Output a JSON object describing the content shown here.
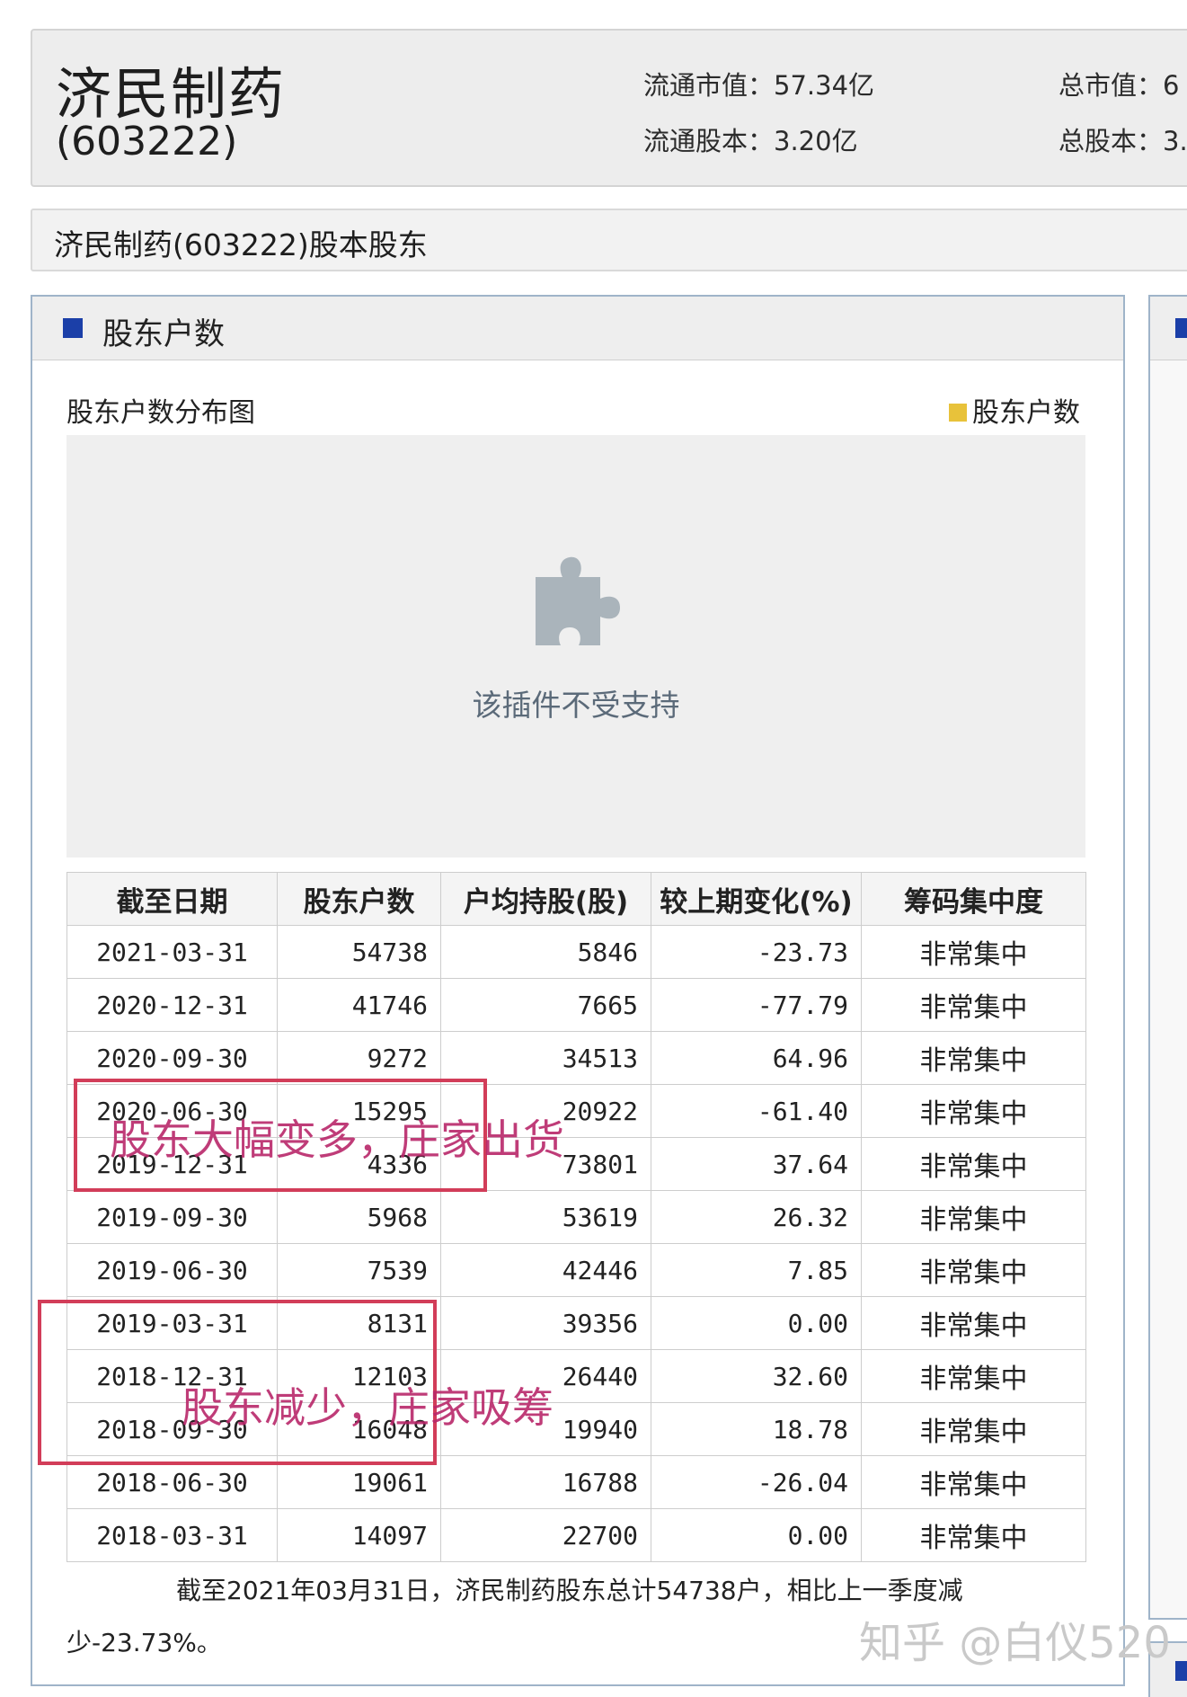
{
  "header": {
    "stock_name": "济民制药",
    "stock_code": "(603222)",
    "float_mv_label": "流通市值：",
    "float_mv_value": "57.34亿",
    "total_mv_label": "总市值：",
    "total_mv_value": "6",
    "float_shares_label": "流通股本：",
    "float_shares_value": "3.20亿",
    "total_shares_label": "总股本：",
    "total_shares_value": "3."
  },
  "subtitle": "济民制药(603222)股本股东",
  "panel": {
    "title": "股东户数",
    "chart_title": "股东户数分布图",
    "legend_label": "股东户数",
    "legend_color": "#e8c23a",
    "plugin_message": "该插件不受支持",
    "plugin_icon": "puzzle-piece-icon"
  },
  "table": {
    "headers": [
      "截至日期",
      "股东户数",
      "户均持股(股)",
      "较上期变化(%)",
      "筹码集中度"
    ],
    "rows": [
      [
        "2021-03-31",
        "54738",
        "5846",
        "-23.73",
        "非常集中"
      ],
      [
        "2020-12-31",
        "41746",
        "7665",
        "-77.79",
        "非常集中"
      ],
      [
        "2020-09-30",
        "9272",
        "34513",
        "64.96",
        "非常集中"
      ],
      [
        "2020-06-30",
        "15295",
        "20922",
        "-61.40",
        "非常集中"
      ],
      [
        "2019-12-31",
        "4336",
        "73801",
        "37.64",
        "非常集中"
      ],
      [
        "2019-09-30",
        "5968",
        "53619",
        "26.32",
        "非常集中"
      ],
      [
        "2019-06-30",
        "7539",
        "42446",
        "7.85",
        "非常集中"
      ],
      [
        "2019-03-31",
        "8131",
        "39356",
        "0.00",
        "非常集中"
      ],
      [
        "2018-12-31",
        "12103",
        "26440",
        "32.60",
        "非常集中"
      ],
      [
        "2018-09-30",
        "16048",
        "19940",
        "18.78",
        "非常集中"
      ],
      [
        "2018-06-30",
        "19061",
        "16788",
        "-26.04",
        "非常集中"
      ],
      [
        "2018-03-31",
        "14097",
        "22700",
        "0.00",
        "非常集中"
      ]
    ]
  },
  "summary": {
    "line1": "截至2021年03月31日，济民制药股东总计54738户，相比上一季度减",
    "line2": "少-23.73%。"
  },
  "annotations": {
    "note1": "股东大幅变多，庄家出货",
    "note2": "股东减少，庄家吸筹",
    "color": "#d23d59"
  },
  "watermark": "知乎 @白仪520"
}
